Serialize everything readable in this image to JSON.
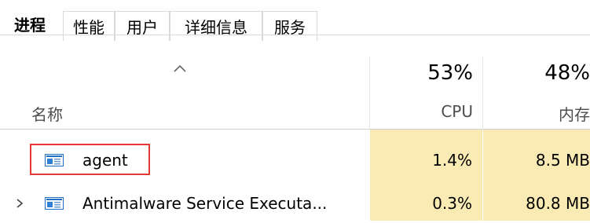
{
  "tabs": [
    {
      "label": "进程",
      "active": true
    },
    {
      "label": "性能",
      "active": false
    },
    {
      "label": "用户",
      "active": false
    },
    {
      "label": "详细信息",
      "active": false
    },
    {
      "label": "服务",
      "active": false
    }
  ],
  "columns": {
    "name": {
      "label": "名称"
    },
    "cpu": {
      "percent": "53%",
      "label": "CPU"
    },
    "memory": {
      "percent": "48%",
      "label": "内存"
    }
  },
  "processes": [
    {
      "name": "agent",
      "cpu": "1.4%",
      "memory": "8.5 MB",
      "expandable": false,
      "highlighted": true
    },
    {
      "name": "Antimalware Service Executa...",
      "cpu": "0.3%",
      "memory": "80.8 MB",
      "expandable": true,
      "highlighted": false
    }
  ],
  "icons": {
    "sort": "sort-ascending-icon",
    "app": "app-window-icon",
    "expand": "chevron-right-icon"
  },
  "colors": {
    "highlight_column": "#f9ebb3",
    "annotation_border": "#e53935"
  }
}
